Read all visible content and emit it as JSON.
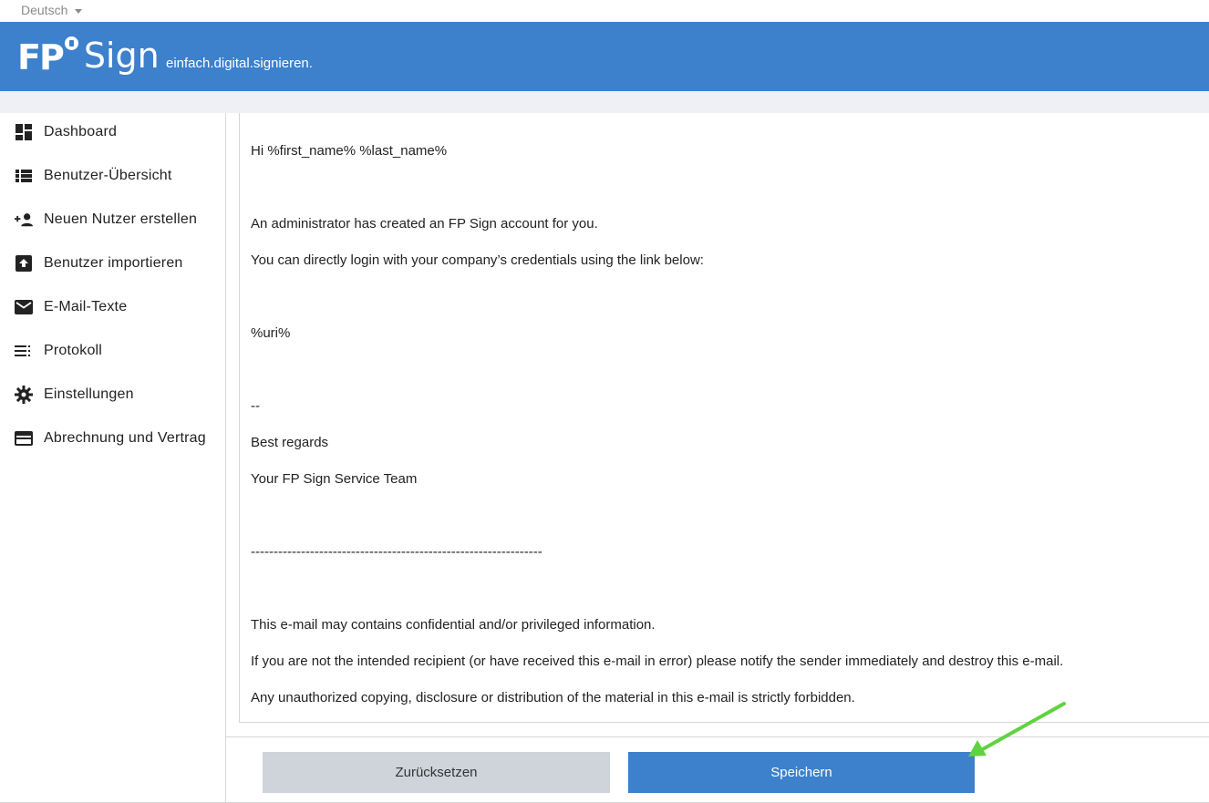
{
  "language": {
    "selected": "Deutsch"
  },
  "header": {
    "logo_fp": "FP",
    "logo_sign": "Sign",
    "tagline": "einfach.digital.signieren."
  },
  "sidebar": {
    "items": [
      {
        "label": "Dashboard",
        "icon": "dashboard-icon"
      },
      {
        "label": "Benutzer-Übersicht",
        "icon": "list-icon"
      },
      {
        "label": "Neuen Nutzer erstellen",
        "icon": "person-add-icon"
      },
      {
        "label": "Benutzer importieren",
        "icon": "import-icon"
      },
      {
        "label": "E-Mail-Texte",
        "icon": "mail-icon"
      },
      {
        "label": "Protokoll",
        "icon": "protocol-list-icon"
      },
      {
        "label": "Einstellungen",
        "icon": "gear-icon"
      },
      {
        "label": "Abrechnung und Vertrag",
        "icon": "credit-card-icon"
      }
    ]
  },
  "email": {
    "lines": [
      "Hi %first_name% %last_name%",
      "An administrator has created an FP Sign account for you.",
      "You can directly login with your company’s credentials using the link below:",
      "%uri%",
      "--",
      "Best regards",
      "Your FP Sign Service Team",
      "----------------------------------------------------------------",
      "This e-mail may contains confidential and/or privileged information.",
      "If you are not the intended recipient (or have received this e-mail in error) please notify the sender immediately and destroy this e-mail.",
      "Any unauthorized copying, disclosure or distribution of the material in this e-mail is strictly forbidden."
    ]
  },
  "actions": {
    "reset_label": "Zurücksetzen",
    "save_label": "Speichern"
  },
  "colors": {
    "brand": "#3d80cb",
    "reset_button": "#cfd4db",
    "annotation_arrow": "#5fd33f"
  }
}
